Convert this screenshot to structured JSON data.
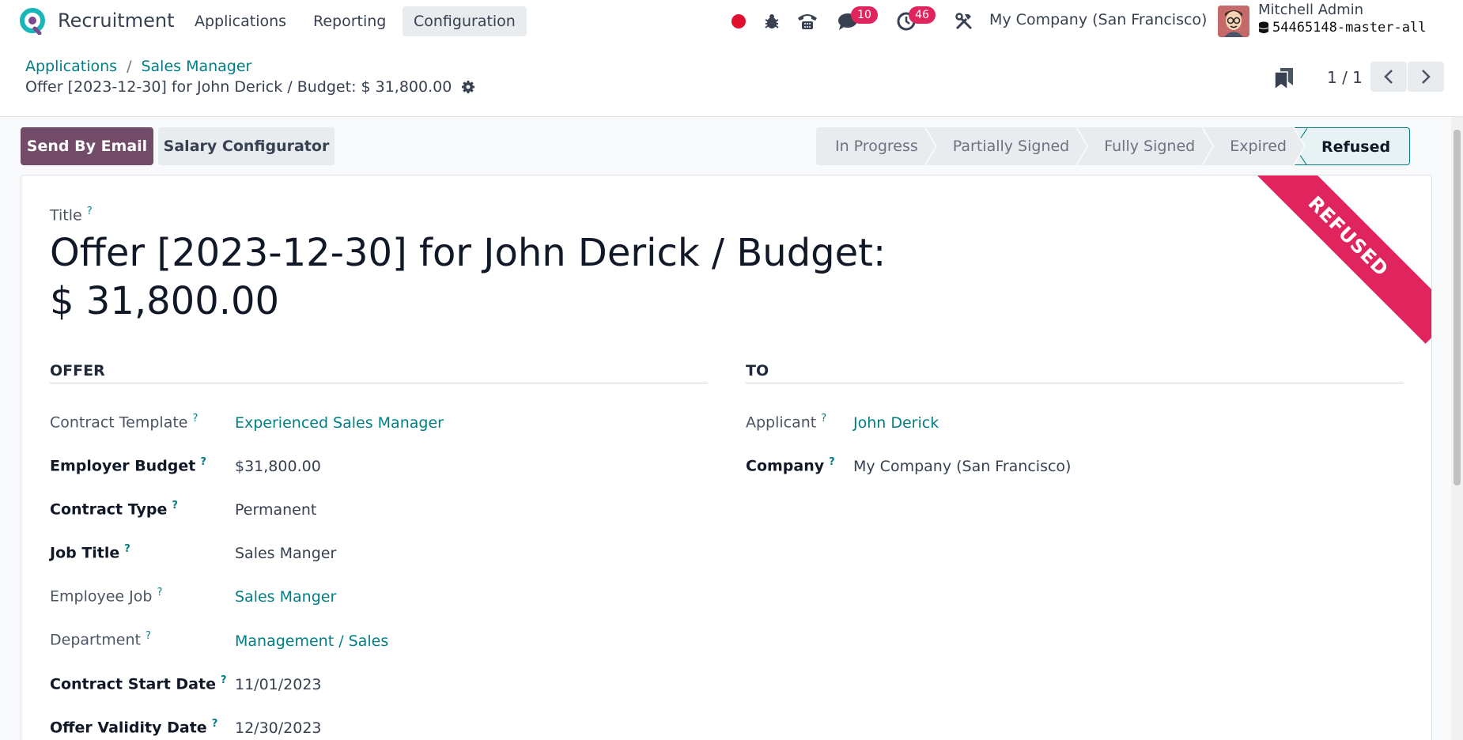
{
  "navbar": {
    "app_name": "Recruitment",
    "menus": [
      "Applications",
      "Reporting",
      "Configuration"
    ],
    "active_menu": "Configuration",
    "messages_badge": "10",
    "activities_badge": "46",
    "company": "My Company (San Francisco)",
    "user_name": "Mitchell Admin",
    "database": "54465148-master-all"
  },
  "breadcrumb": {
    "items": [
      "Applications",
      "Sales Manager"
    ],
    "current": "Offer [2023-12-30] for John Derick / Budget: $ 31,800.00"
  },
  "pager": {
    "value": "1 / 1"
  },
  "actions": {
    "send_email": "Send By Email",
    "salary_configurator": "Salary Configurator"
  },
  "statusbar": {
    "stages": [
      "In Progress",
      "Partially Signed",
      "Fully Signed",
      "Expired",
      "Refused"
    ],
    "current": "Refused"
  },
  "form": {
    "ribbon": "REFUSED",
    "title_label": "Title",
    "title_line1": "Offer [2023-12-30] for John Derick / Budget:",
    "title_line2": "$ 31,800.00",
    "offer_group": "OFFER",
    "to_group": "TO",
    "offer_fields": [
      {
        "label": "Contract Template",
        "value": "Experienced Sales Manager"
      },
      {
        "label": "Employer Budget",
        "value": "$31,800.00"
      },
      {
        "label": "Contract Type",
        "value": "Permanent"
      },
      {
        "label": "Job Title",
        "value": "Sales Manger"
      },
      {
        "label": "Employee Job",
        "value": "Sales Manger"
      },
      {
        "label": "Department",
        "value": "Management / Sales"
      },
      {
        "label": "Contract Start Date",
        "value": "11/01/2023"
      },
      {
        "label": "Offer Validity Date",
        "value": "12/30/2023"
      }
    ],
    "to_fields": [
      {
        "label": "Applicant",
        "value": "John Derick"
      },
      {
        "label": "Company",
        "value": "My Company (San Francisco)"
      }
    ],
    "help_mark": "?"
  },
  "colors": {
    "brand": "#714b67",
    "link": "#017e84",
    "danger": "#e0245e"
  }
}
